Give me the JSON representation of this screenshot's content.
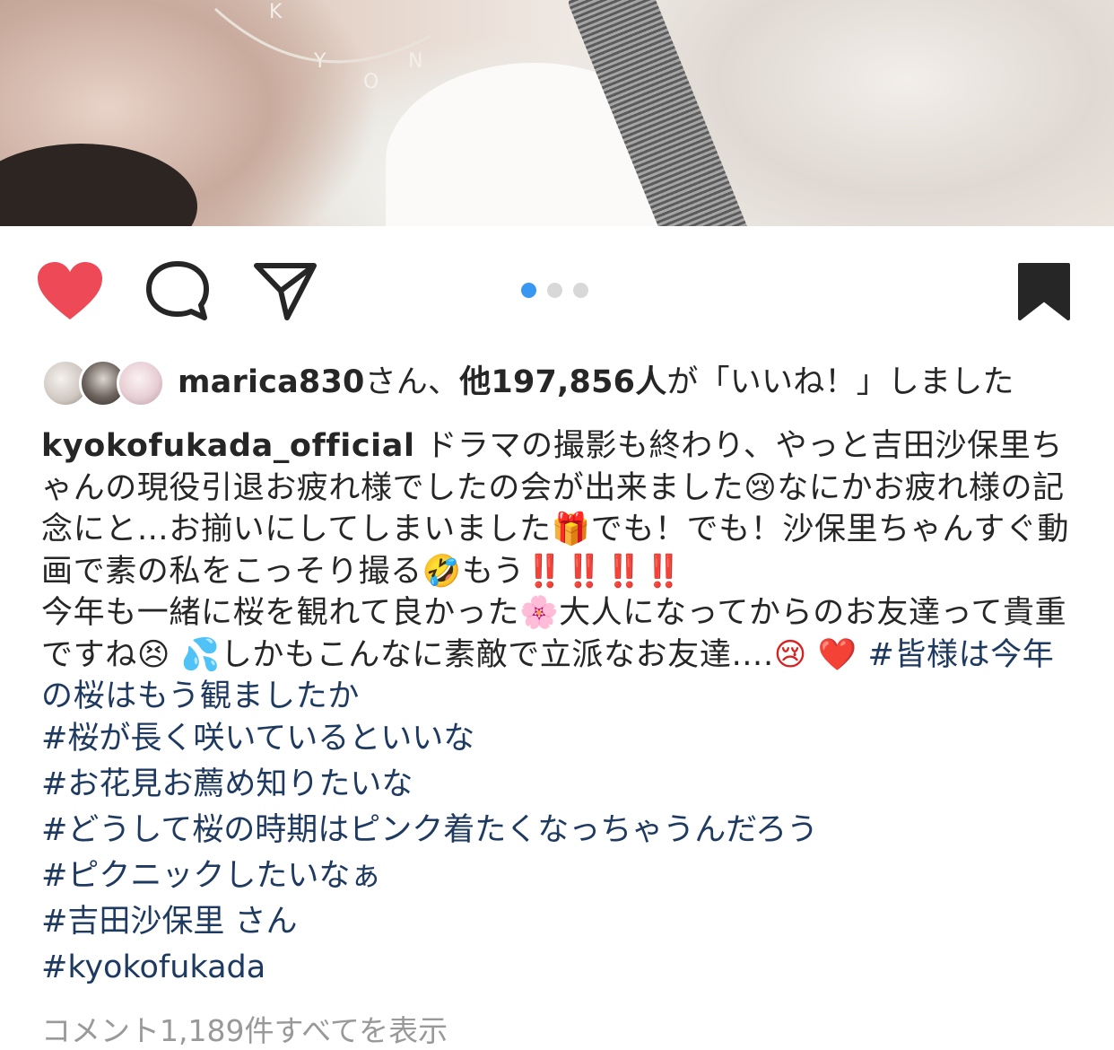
{
  "post": {
    "photo_alt": "",
    "carousel_dots": 3,
    "carousel_active": 1
  },
  "actions": {
    "liked": true,
    "saved": true,
    "like_color": "#ed4956"
  },
  "likes": {
    "first_user": "marica830",
    "suffix1": "さん、",
    "others": "他197,856人",
    "suffix2": "が「いいね！」しました"
  },
  "caption": {
    "username": "kyokofukada_official",
    "line1": " ドラマの撮影も終わり、やっと吉田沙保里ちゃんの現役引退お疲れ様でしたの会が出来ました",
    "emoji1": "😢",
    "line2": "なにかお疲れ様の記念にと…お揃いにしてしまいました",
    "emoji2": "🎁",
    "line3": "でも！でも！沙保里ちゃんすぐ動画で素の私をこっそり撮る",
    "emoji3": "🤣",
    "line4": "もう",
    "emoji4": "‼️‼️‼️‼️",
    "line5": "今年も一緒に桜を観れて良かった",
    "emoji5": "🌸",
    "line6": "大人になってからのお友達って貴重ですね",
    "emoji6": "😣 💦",
    "line7": "しかもこんなに素敵で立派なお友達….",
    "emoji7": "😢 ❤️",
    "tag_inline": " #皆様は今年の桜はもう観ましたか"
  },
  "hashtags": [
    "#桜が長く咲いているといいな",
    "#お花見お薦め知りたいな",
    "#どうして桜の時期はピンク着たくなっちゃうんだろう",
    "#ピクニックしたいなぁ",
    "#吉田沙保里 さん",
    "#kyokofukada"
  ],
  "comments": {
    "view_all": "コメント1,189件すべてを表示"
  }
}
